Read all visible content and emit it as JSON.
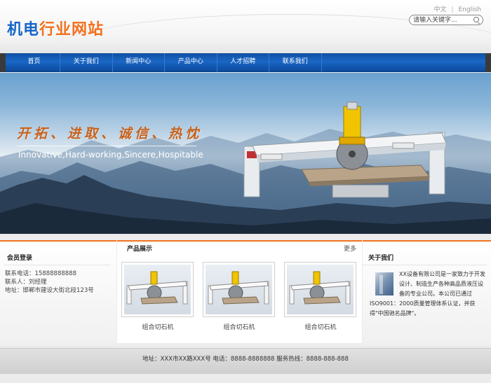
{
  "header": {
    "logo_part1": "机电",
    "logo_part2": "行业网站",
    "lang_cn": "中文",
    "lang_sep": "|",
    "lang_en": "English",
    "search_placeholder": "请输入关键字..."
  },
  "nav": {
    "items": [
      {
        "label": "首页"
      },
      {
        "label": "关于我们"
      },
      {
        "label": "新闻中心"
      },
      {
        "label": "产品中心"
      },
      {
        "label": "人才招聘"
      },
      {
        "label": "联系我们"
      }
    ]
  },
  "banner": {
    "slogan": "开拓、进取、诚信、热忱",
    "slogan_en": "Innovative,Hard-working,Sincere,Hospitable"
  },
  "member": {
    "title": "会员登录",
    "phone": "联系电话：15888888888",
    "contact": "联系人：刘经理",
    "address": "地址：邯郸市建设大街北段123号"
  },
  "products": {
    "title": "产品展示",
    "more": "更多",
    "items": [
      {
        "caption": "组合切石机"
      },
      {
        "caption": "组合切石机"
      },
      {
        "caption": "组合切石机"
      }
    ]
  },
  "about": {
    "title": "关于我们",
    "text": "XX设备有限公司是一家致力于开发设计、制造生产各种高品质液压设备的专业公司。本公司已通过ISO9001：2000质量管理体系认证，并获得\"中国驰名品牌\"。"
  },
  "footer": {
    "text": "地址：XXX市XX路XXX号 电话：8888-8888888 服务热线：8888-888-888"
  },
  "colors": {
    "brand_blue": "#1666c9",
    "brand_orange": "#f2711d",
    "nav_blue": "#1a67c6"
  }
}
